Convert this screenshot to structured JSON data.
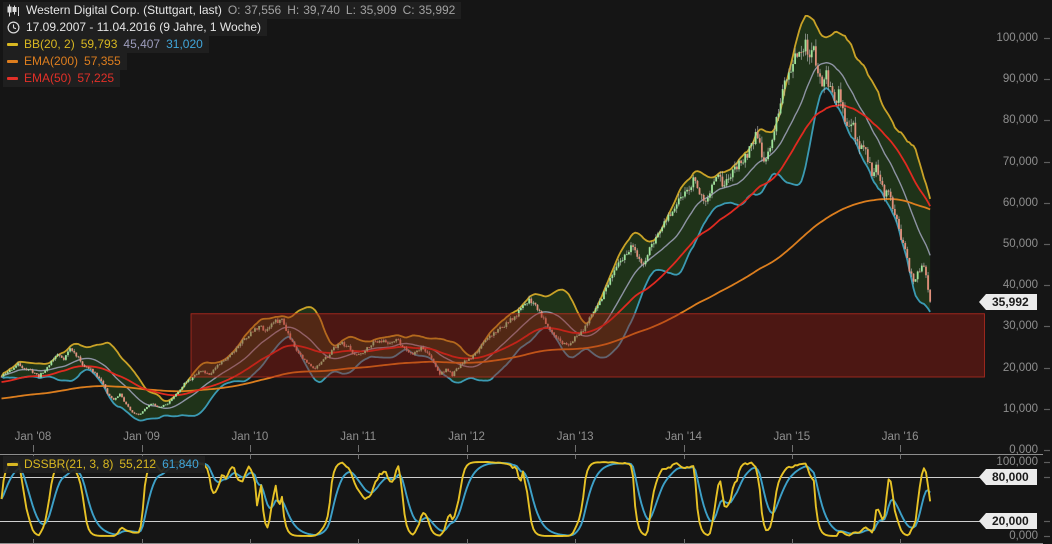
{
  "header": {
    "title": "Western Digital Corp. (Stuttgart, last)",
    "ohlc": {
      "o_label": "O:",
      "o": "37,556",
      "h_label": "H:",
      "h": "39,740",
      "l_label": "L:",
      "l": "35,909",
      "c_label": "C:",
      "c": "35,992"
    },
    "date_range": "17.09.2007 - 11.04.2016 (9 Jahre, 1 Woche)"
  },
  "legend": {
    "bb": {
      "label": "BB(20, 2)",
      "upper": "59,793",
      "middle": "45,407",
      "lower": "31,020"
    },
    "ema200": {
      "label": "EMA(200)",
      "value": "57,355"
    },
    "ema50": {
      "label": "EMA(50)",
      "value": "57,225"
    }
  },
  "price_axis": {
    "ticks": [
      {
        "text": "100,000",
        "value": 100
      },
      {
        "text": "90,000",
        "value": 90
      },
      {
        "text": "80,000",
        "value": 80
      },
      {
        "text": "70,000",
        "value": 70
      },
      {
        "text": "60,000",
        "value": 60
      },
      {
        "text": "50,000",
        "value": 50
      },
      {
        "text": "40,000",
        "value": 40
      },
      {
        "text": "30,000",
        "value": 30
      },
      {
        "text": "20,000",
        "value": 20
      },
      {
        "text": "10,000",
        "value": 10
      },
      {
        "text": "0,000",
        "value": 0
      }
    ],
    "last_price_tag": {
      "text": "35,992",
      "value": 35.992
    }
  },
  "x_axis": {
    "labels": [
      "Jan '08",
      "Jan '09",
      "Jan '10",
      "Jan '11",
      "Jan '12",
      "Jan '13",
      "Jan '14",
      "Jan '15",
      "Jan '16"
    ]
  },
  "oscillator": {
    "label": "DSSBR(21, 3, 8)",
    "value_fast": "55,212",
    "value_slow": "61,840",
    "axis_ticks": [
      {
        "text": "100,000",
        "value": 100
      },
      {
        "text": "0,000",
        "value": 0
      }
    ],
    "tags": [
      {
        "text": "80,000",
        "value": 80
      },
      {
        "text": "20,000",
        "value": 20
      }
    ]
  },
  "colors": {
    "background": "#151515",
    "bb_upper": "#c9a227",
    "bb_middle": "#8e93a4",
    "bb_lower": "#3b9ab3",
    "bb_fill": "rgba(48,98,32,0.40)",
    "ema50": "#e02a20",
    "ema200": "#dc7e1e",
    "candle_up": "#9fe39b",
    "candle_down": "#e1907b",
    "wick": "rgba(190,190,190,0.75)",
    "zone_fill": "rgba(152,27,17,0.42)",
    "zone_border": "rgba(219,52,38,0.55)",
    "osc_fast": "#e7c226",
    "osc_slow": "#3da0c8",
    "threshold": "#cfcfcf",
    "pane_border": "#8d8d8d",
    "axis_text": "#8f8f8f",
    "tick": "#6f6f6f",
    "tag_bg": "#ebebeb",
    "tag_text": "#1a1a1a"
  },
  "chart_data": {
    "type": "candlestick",
    "timeframe": "weekly",
    "title": "Western Digital Corp. (Stuttgart, last)",
    "x_start": "17.09.2007",
    "x_end": "11.04.2016",
    "ylim": [
      0,
      105
    ],
    "grid": false,
    "legend_position": "top-left",
    "last_ohlc": {
      "open": 37.556,
      "high": 39.74,
      "low": 35.909,
      "close": 35.992
    },
    "anchors_week_close": [
      [
        0,
        17.8
      ],
      [
        4,
        19.3
      ],
      [
        8,
        20.8
      ],
      [
        12,
        19.6
      ],
      [
        15,
        19.0
      ],
      [
        18,
        17.9
      ],
      [
        21,
        19.3
      ],
      [
        24,
        21.6
      ],
      [
        27,
        23.2
      ],
      [
        30,
        22.2
      ],
      [
        33,
        24.6
      ],
      [
        36,
        23.0
      ],
      [
        40,
        20.2
      ],
      [
        44,
        19.2
      ],
      [
        48,
        17.0
      ],
      [
        51,
        13.6
      ],
      [
        54,
        12.1
      ],
      [
        57,
        13.6
      ],
      [
        60,
        11.0
      ],
      [
        63,
        9.2
      ],
      [
        66,
        8.5
      ],
      [
        69,
        9.8
      ],
      [
        72,
        11.3
      ],
      [
        76,
        10.3
      ],
      [
        80,
        11.3
      ],
      [
        84,
        13.7
      ],
      [
        88,
        16.1
      ],
      [
        92,
        17.6
      ],
      [
        96,
        19.3
      ],
      [
        100,
        18.5
      ],
      [
        104,
        20.3
      ],
      [
        108,
        22.2
      ],
      [
        112,
        24.2
      ],
      [
        116,
        26.5
      ],
      [
        120,
        28.4
      ],
      [
        124,
        30.1
      ],
      [
        127,
        29.0
      ],
      [
        131,
        31.0
      ],
      [
        135,
        31.6
      ],
      [
        139,
        27.2
      ],
      [
        143,
        23.6
      ],
      [
        147,
        21.1
      ],
      [
        151,
        19.9
      ],
      [
        155,
        21.7
      ],
      [
        159,
        24.1
      ],
      [
        163,
        26.1
      ],
      [
        167,
        24.9
      ],
      [
        170,
        22.9
      ],
      [
        174,
        23.8
      ],
      [
        178,
        25.8
      ],
      [
        182,
        26.7
      ],
      [
        186,
        25.9
      ],
      [
        190,
        26.9
      ],
      [
        194,
        24.7
      ],
      [
        198,
        23.4
      ],
      [
        202,
        24.8
      ],
      [
        205,
        23.7
      ],
      [
        208,
        21.1
      ],
      [
        211,
        18.4
      ],
      [
        214,
        19.6
      ],
      [
        217,
        18.2
      ],
      [
        220,
        20.1
      ],
      [
        223,
        21.4
      ],
      [
        227,
        22.8
      ],
      [
        231,
        25.2
      ],
      [
        235,
        27.6
      ],
      [
        239,
        29.2
      ],
      [
        243,
        30.7
      ],
      [
        247,
        32.2
      ],
      [
        251,
        34.7
      ],
      [
        254,
        36.6
      ],
      [
        257,
        35.2
      ],
      [
        260,
        32.7
      ],
      [
        263,
        30.2
      ],
      [
        266,
        28.2
      ],
      [
        269,
        26.2
      ],
      [
        272,
        25.4
      ],
      [
        276,
        27.2
      ],
      [
        280,
        29.4
      ],
      [
        284,
        32.4
      ],
      [
        288,
        36.2
      ],
      [
        292,
        40.2
      ],
      [
        296,
        44.0
      ],
      [
        300,
        47.2
      ],
      [
        303,
        49.4
      ],
      [
        306,
        47.0
      ],
      [
        309,
        45.2
      ],
      [
        312,
        48.5
      ],
      [
        315,
        51.5
      ],
      [
        318,
        54.0
      ],
      [
        321,
        56.5
      ],
      [
        324,
        58.5
      ],
      [
        327,
        61.0
      ],
      [
        330,
        63.5
      ],
      [
        333,
        65.5
      ],
      [
        336,
        62.8
      ],
      [
        339,
        60.8
      ],
      [
        342,
        63.5
      ],
      [
        345,
        66.0
      ],
      [
        348,
        64.0
      ],
      [
        351,
        66.8
      ],
      [
        354,
        68.5
      ],
      [
        357,
        70.5
      ],
      [
        360,
        73.0
      ],
      [
        363,
        76.5
      ],
      [
        365,
        73.5
      ],
      [
        367,
        70.2
      ],
      [
        369,
        72.5
      ],
      [
        371,
        75.5
      ],
      [
        373,
        79.5
      ],
      [
        375,
        84.0
      ],
      [
        377,
        88.5
      ],
      [
        379,
        92.0
      ],
      [
        381,
        94.5
      ],
      [
        383,
        96.5
      ],
      [
        385,
        95.0
      ],
      [
        387,
        98.3
      ],
      [
        389,
        94.5
      ],
      [
        391,
        96.8
      ],
      [
        393,
        92.5
      ],
      [
        395,
        88.8
      ],
      [
        397,
        91.2
      ],
      [
        399,
        87.2
      ],
      [
        401,
        84.2
      ],
      [
        403,
        86.2
      ],
      [
        405,
        81.8
      ],
      [
        407,
        78.2
      ],
      [
        409,
        80.2
      ],
      [
        411,
        76.2
      ],
      [
        413,
        72.6
      ],
      [
        415,
        74.6
      ],
      [
        417,
        70.8
      ],
      [
        419,
        67.4
      ],
      [
        421,
        69.2
      ],
      [
        423,
        65.2
      ],
      [
        425,
        61.8
      ],
      [
        427,
        63.4
      ],
      [
        429,
        59.2
      ],
      [
        431,
        55.4
      ],
      [
        433,
        51.6
      ],
      [
        435,
        48.4
      ],
      [
        437,
        43.6
      ],
      [
        439,
        40.6
      ],
      [
        441,
        42.8
      ],
      [
        443,
        45.2
      ],
      [
        445,
        42.4
      ],
      [
        446,
        39.2
      ],
      [
        447,
        35.992
      ]
    ],
    "indicators": [
      {
        "name": "BB",
        "params": [
          20,
          2
        ],
        "last": {
          "upper": 59.793,
          "middle": 45.407,
          "lower": 31.02
        }
      },
      {
        "name": "EMA",
        "params": [
          200
        ],
        "last": 57.355
      },
      {
        "name": "EMA",
        "params": [
          50
        ],
        "last": 57.225
      },
      {
        "name": "DSSBR",
        "params": [
          21,
          3,
          8
        ],
        "last_fast": 55.212,
        "last_slow": 61.84,
        "range": [
          0,
          100
        ],
        "thresholds": [
          20,
          80
        ]
      }
    ],
    "support_zone": {
      "price_top": 33.2,
      "price_bottom": 17.6,
      "from_week": 91,
      "to": "right-edge"
    }
  }
}
